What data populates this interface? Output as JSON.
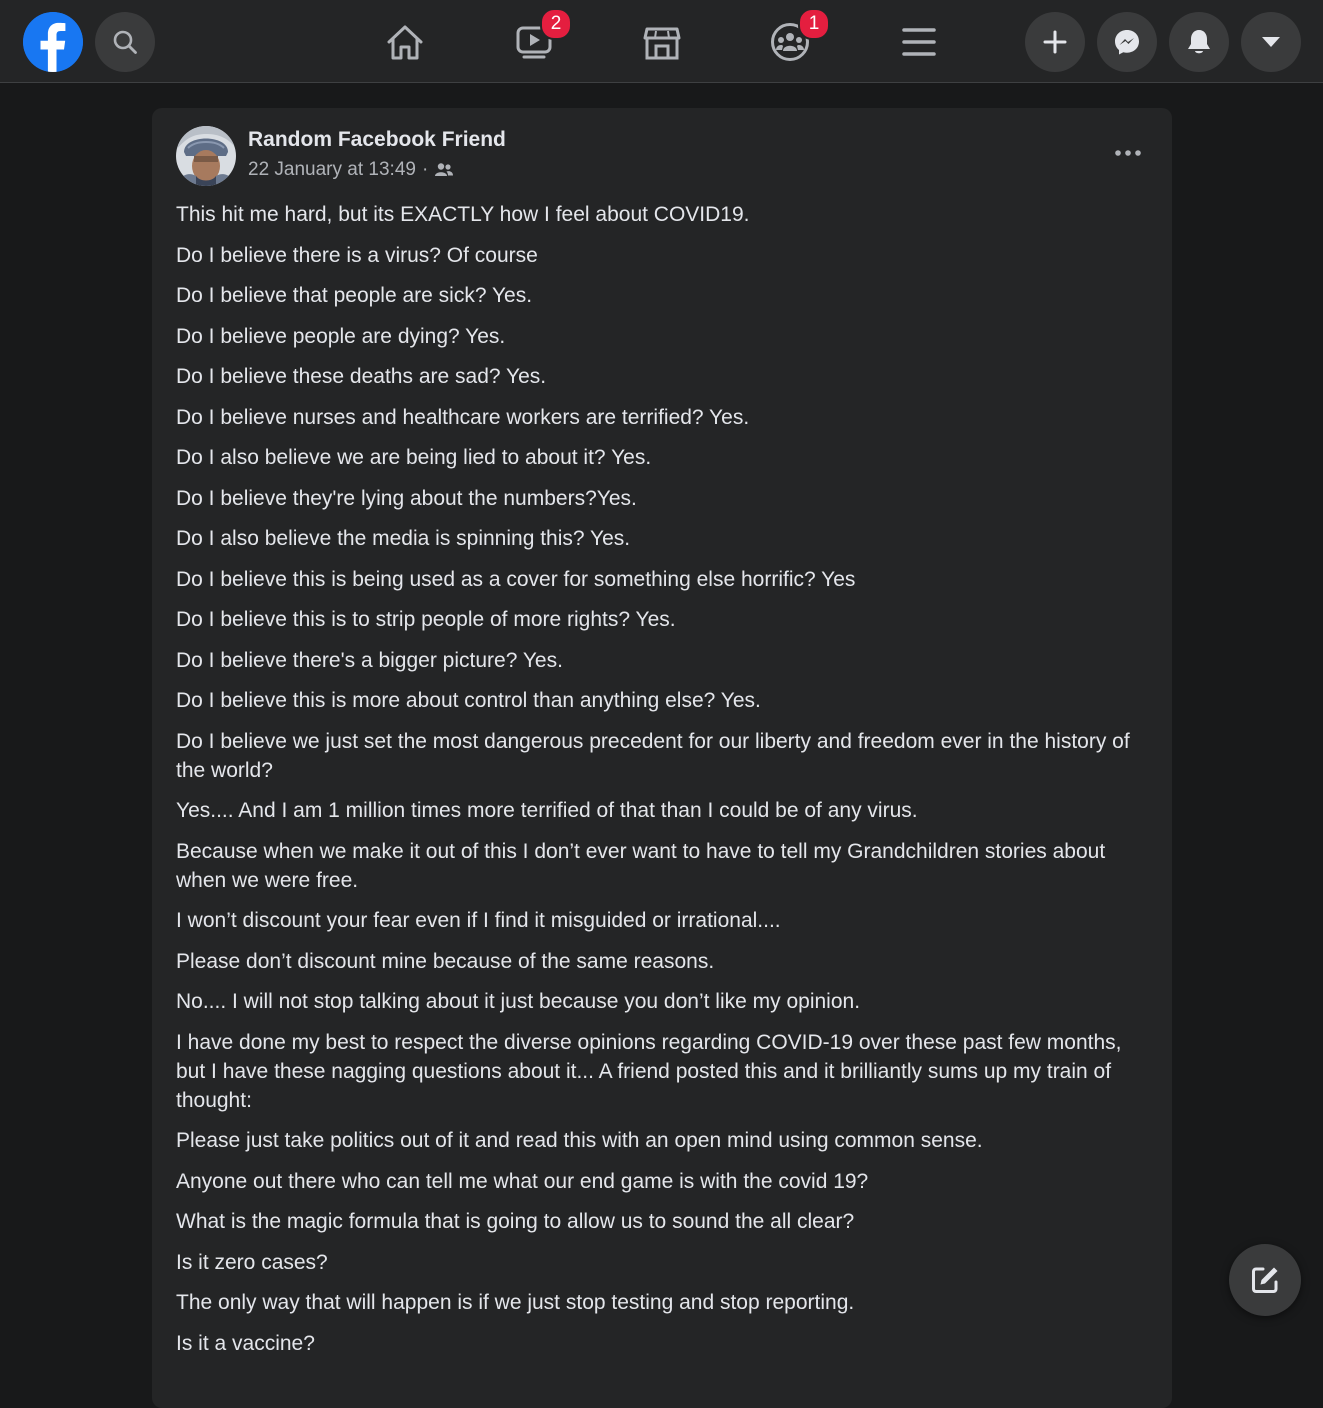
{
  "nav": {
    "watch_badge": "2",
    "groups_badge": "1"
  },
  "post": {
    "author": "Random Facebook Friend",
    "timestamp": "22 January at 13:49",
    "separator": "·",
    "audience_icon": "friends-icon",
    "lines": [
      "This hit me hard, but its EXACTLY how I feel about COVID19.",
      "Do I believe there is a virus? Of course",
      "Do I believe that people are sick? Yes.",
      "Do I believe people are dying? Yes.",
      "Do I believe these deaths are sad? Yes.",
      "Do I believe nurses and healthcare workers are terrified? Yes.",
      "Do I also believe we are being lied to about it? Yes.",
      "Do I believe they're lying about the numbers?Yes.",
      "Do I also believe the media is spinning this? Yes.",
      "Do I believe this is being used as a cover for something else horrific? Yes",
      "Do I believe this is to strip people of more rights? Yes.",
      "Do I believe there's a bigger picture? Yes.",
      "Do I believe this is more about control than anything else? Yes.",
      "Do I believe we just set the most dangerous precedent for our liberty and freedom ever in the history of the world?",
      "Yes.... And I am 1 million times more terrified of that than I could be of any virus.",
      "Because when we make it out of this I don’t ever want to have to tell my Grandchildren stories about when we were free.",
      "I won’t discount your fear even if I find it misguided or irrational....",
      "Please don’t discount mine because of the same reasons.",
      "No.... I will not stop talking about it just because you don’t like my opinion.",
      "I have done my best to respect the diverse opinions regarding COVID-19 over these past few months, but I have these nagging questions about it... A friend posted this and it brilliantly sums up my train of thought:",
      "Please just take politics out of it and read this with an open mind using common sense.",
      "Anyone out there who can tell me what our end game is with the covid 19?",
      "What is the magic formula that is going to allow us to sound the all clear?",
      "Is it zero cases?",
      "The only way that will happen is if we just stop testing and stop reporting.",
      "Is it a vaccine?"
    ]
  },
  "colors": {
    "background": "#18191a",
    "surface": "#242526",
    "button": "#3a3b3c",
    "brand": "#1877f2",
    "badge": "#e41e3f",
    "text_primary": "#e4e6eb",
    "text_secondary": "#b0b3b8"
  }
}
